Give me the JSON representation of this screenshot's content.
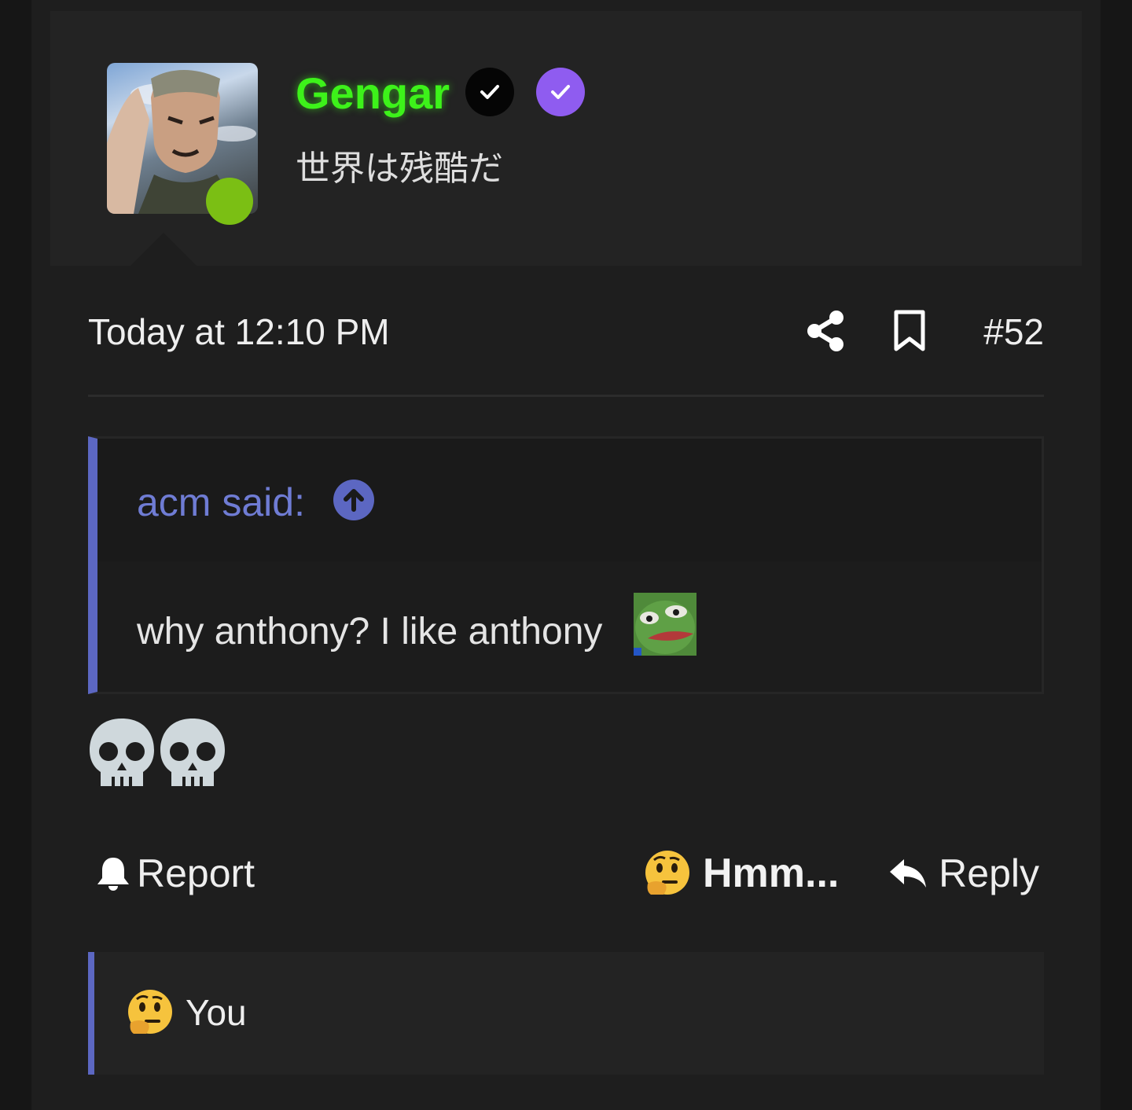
{
  "user": {
    "name": "Gengar",
    "title": "世界は残酷だ",
    "name_color": "#3df21a",
    "online_color": "#7bbf14",
    "badges": [
      "check-badge-black-icon",
      "check-badge-purple-icon"
    ]
  },
  "meta": {
    "timestamp": "Today at 12:10 PM",
    "post_number": "#52"
  },
  "quote": {
    "author": "acm said:",
    "body": "why anthony? I like anthony",
    "accent": "#5c67c2"
  },
  "message": {
    "emojis": [
      "skull-icon",
      "skull-icon"
    ]
  },
  "actions": {
    "report_label": "Report",
    "reaction_label": "Hmm...",
    "reply_label": "Reply"
  },
  "reactions": {
    "label": "You"
  }
}
